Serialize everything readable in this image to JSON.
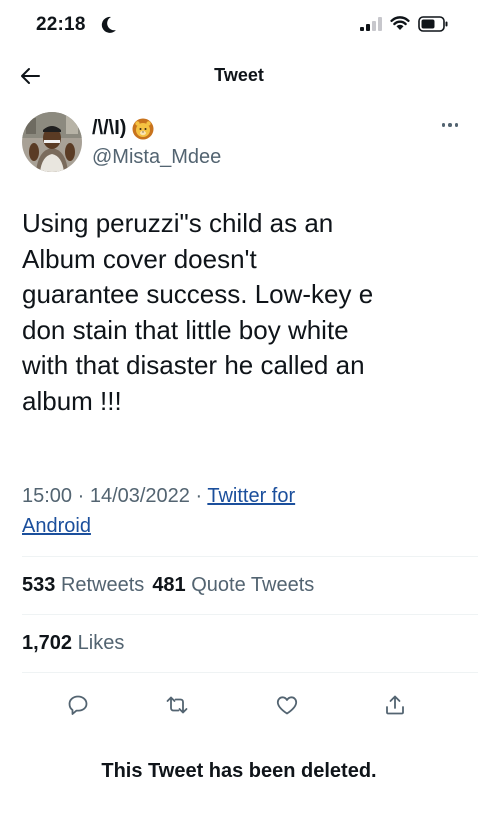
{
  "status_bar": {
    "time": "22:18"
  },
  "nav": {
    "title": "Tweet"
  },
  "author": {
    "display_name": "/\\/\\I)",
    "handle": "@Mista_Mdee"
  },
  "tweet": {
    "lines": [
      "Using peruzzi\"s child as an",
      "Album cover doesn't",
      "guarantee success. Low-key e",
      "don stain that little boy white",
      "with that disaster he called an",
      "album !!!"
    ],
    "timestamp": "15:00 · 14/03/2022 · ",
    "source_line1": "Twitter for",
    "source_line2": "Android"
  },
  "stats": {
    "retweets_count": "533",
    "retweets_label": "Retweets",
    "quotes_count": "481",
    "quotes_label": "Quote Tweets",
    "likes_count": "1,702",
    "likes_label": "Likes"
  },
  "notice": "This Tweet has been deleted.",
  "colors": {
    "text": "#0f1419",
    "secondary": "#536471",
    "link": "#1b4f9c",
    "divider": "#eff3f4"
  }
}
